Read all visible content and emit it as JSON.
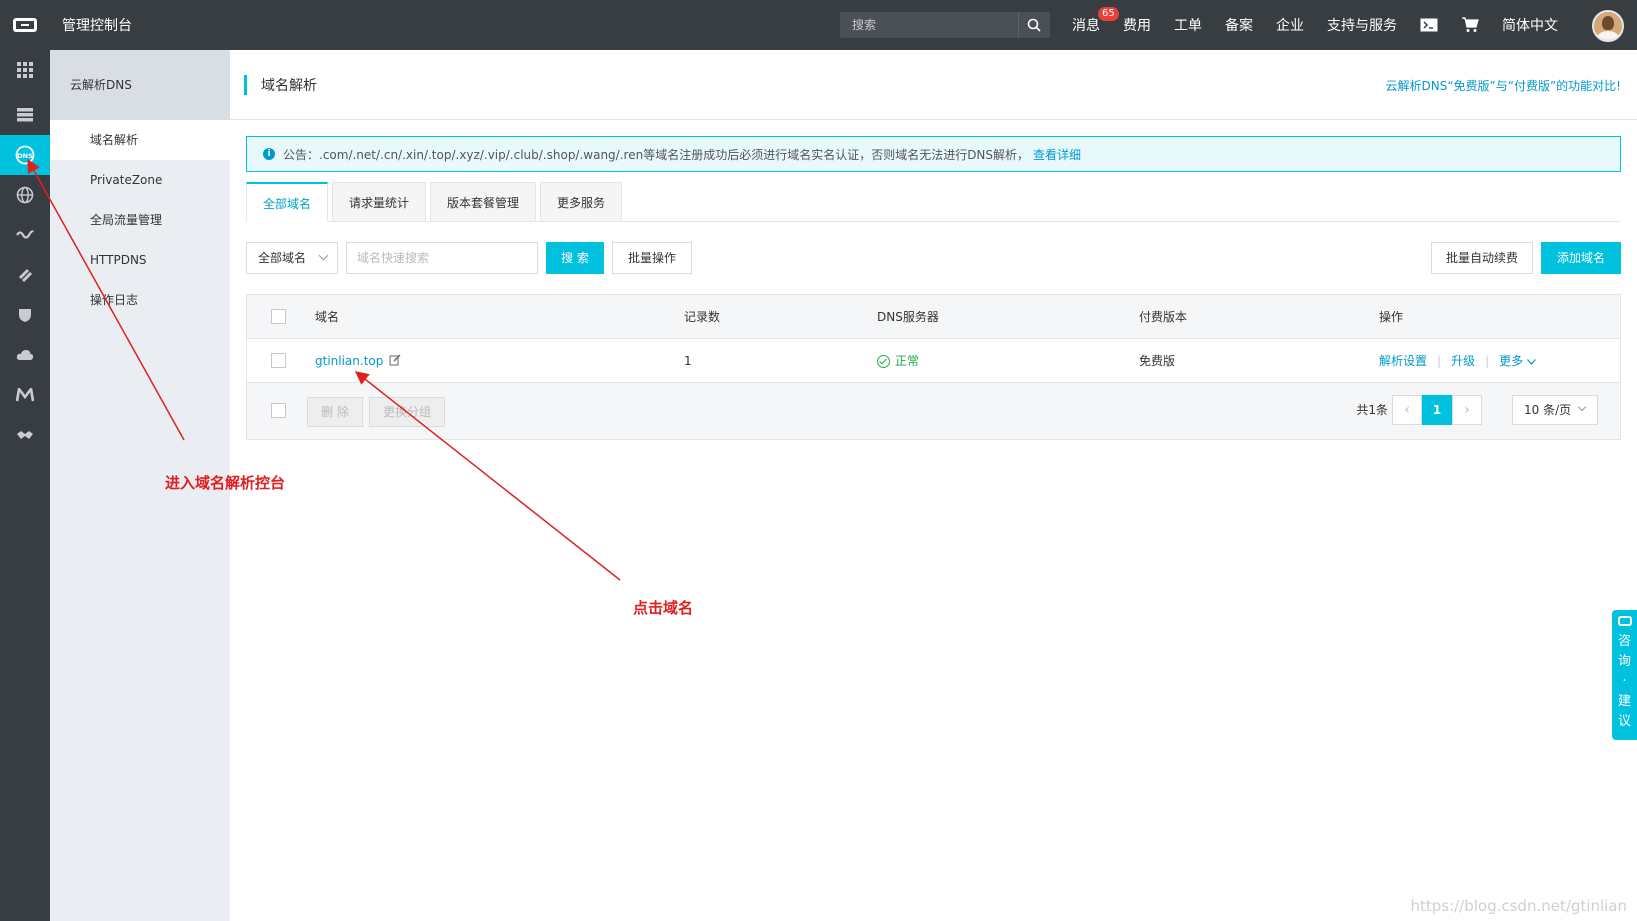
{
  "topbar": {
    "title": "管理控制台",
    "search_placeholder": "搜索",
    "nav": {
      "messages": "消息",
      "messages_badge": "65",
      "billing": "费用",
      "tickets": "工单",
      "icp": "备案",
      "enterprise": "企业",
      "support": "支持与服务",
      "language": "简体中文"
    }
  },
  "rail": {
    "icons": [
      "grid-icon",
      "storage-icon",
      "dns-icon",
      "globe-icon",
      "wave-icon",
      "link-icon",
      "shield-icon",
      "cloud-icon",
      "m-icon",
      "handshake-icon"
    ]
  },
  "sidebar": {
    "title": "云解析DNS",
    "items": [
      {
        "label": "域名解析"
      },
      {
        "label": "PrivateZone"
      },
      {
        "label": "全局流量管理"
      },
      {
        "label": "HTTPDNS"
      },
      {
        "label": "操作日志"
      }
    ]
  },
  "main": {
    "title": "域名解析",
    "compare_link": "云解析DNS“免费版”与“付费版”的功能对比!",
    "notice": {
      "text": "公告：.com/.net/.cn/.xin/.top/.xyz/.vip/.club/.shop/.wang/.ren等域名注册成功后必须进行域名实名认证，否则域名无法进行DNS解析，",
      "link": "查看详细"
    },
    "tabs": [
      {
        "label": "全部域名"
      },
      {
        "label": "请求量统计"
      },
      {
        "label": "版本套餐管理"
      },
      {
        "label": "更多服务"
      }
    ],
    "toolbar": {
      "filter_select": "全部域名",
      "search_placeholder": "域名快速搜索",
      "search_button": "搜 索",
      "batch_button": "批量操作",
      "auto_renew_button": "批量自动续费",
      "add_domain_button": "添加域名"
    },
    "table": {
      "headers": {
        "domain": "域名",
        "records": "记录数",
        "dns_server": "DNS服务器",
        "paid_version": "付费版本",
        "actions": "操作"
      },
      "rows": [
        {
          "domain": "gtinlian.top",
          "records": "1",
          "dns_status": "正常",
          "version": "免费版",
          "actions": {
            "settings": "解析设置",
            "upgrade": "升级",
            "more": "更多"
          }
        }
      ],
      "footer": {
        "delete_button": "删 除",
        "change_group_button": "更换分组",
        "total": "共1条",
        "current_page": "1",
        "page_size": "10 条/页"
      }
    }
  },
  "annotations": {
    "enter_console": "进入域名解析控台",
    "click_domain": "点击域名"
  },
  "consult_tab": [
    "咨",
    "询",
    "·",
    "建",
    "议"
  ],
  "watermark": "https://blog.csdn.net/gtinlian",
  "colors": {
    "accent": "#00c1de",
    "topbar": "#373d41",
    "link": "#0099cc",
    "annotation": "#e02020",
    "ok": "#1eab4a"
  }
}
